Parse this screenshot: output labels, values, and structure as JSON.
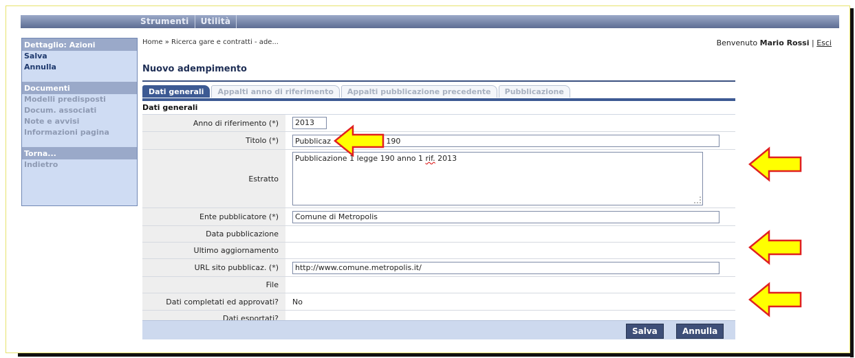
{
  "menubar": {
    "items": [
      "Strumenti",
      "Utilità"
    ]
  },
  "sidebar": {
    "sections": [
      {
        "header": "Dettaglio: Azioni",
        "items": [
          {
            "label": "Salva",
            "enabled": true
          },
          {
            "label": "Annulla",
            "enabled": true
          }
        ]
      },
      {
        "header": "Documenti",
        "items": [
          {
            "label": "Modelli predisposti",
            "enabled": false
          },
          {
            "label": "Docum. associati",
            "enabled": false
          },
          {
            "label": "Note e avvisi",
            "enabled": false
          },
          {
            "label": "Informazioni pagina",
            "enabled": false
          }
        ]
      },
      {
        "header": "Torna...",
        "items": [
          {
            "label": "Indietro",
            "enabled": false
          }
        ]
      }
    ]
  },
  "header": {
    "breadcrumb": "Home » Ricerca gare e contratti - ade...",
    "welcome_prefix": "Benvenuto",
    "user_name": "Mario Rossi",
    "separator": "|",
    "logout_label": "Esci"
  },
  "page": {
    "title": "Nuovo adempimento",
    "tabs": [
      "Dati generali",
      "Appalti anno di riferimento",
      "Appalti pubblicazione precedente",
      "Pubblicazione"
    ],
    "active_tab": 0,
    "section_title": "Dati generali"
  },
  "form": {
    "anno_label": "Anno di riferimento (*)",
    "anno_value": "2013",
    "titolo_label": "Titolo (*)",
    "titolo_value_visible_start": "Pubblicaz",
    "titolo_value_visible_end": "e 190",
    "estratto_label": "Estratto",
    "estratto_text_before": "Pubblicazione 1 legge 190 anno 1 ",
    "estratto_text_spell": "rif.",
    "estratto_text_after": " 2013",
    "ente_label": "Ente pubblicatore (*)",
    "ente_value": "Comune di Metropolis",
    "data_pub_label": "Data pubblicazione",
    "ultimo_agg_label": "Ultimo aggiornamento",
    "url_label": "URL sito pubblicaz. (*)",
    "url_value": "http://www.comune.metropolis.it/",
    "file_label": "File",
    "completati_label": "Dati completati ed approvati?",
    "completati_value": "No",
    "esportati_label": "Dati esportati?"
  },
  "buttons": {
    "save": "Salva",
    "cancel": "Annulla"
  },
  "colors": {
    "arrow_fill": "#ffff00",
    "arrow_stroke": "#e02020",
    "accent": "#3d5a93"
  }
}
